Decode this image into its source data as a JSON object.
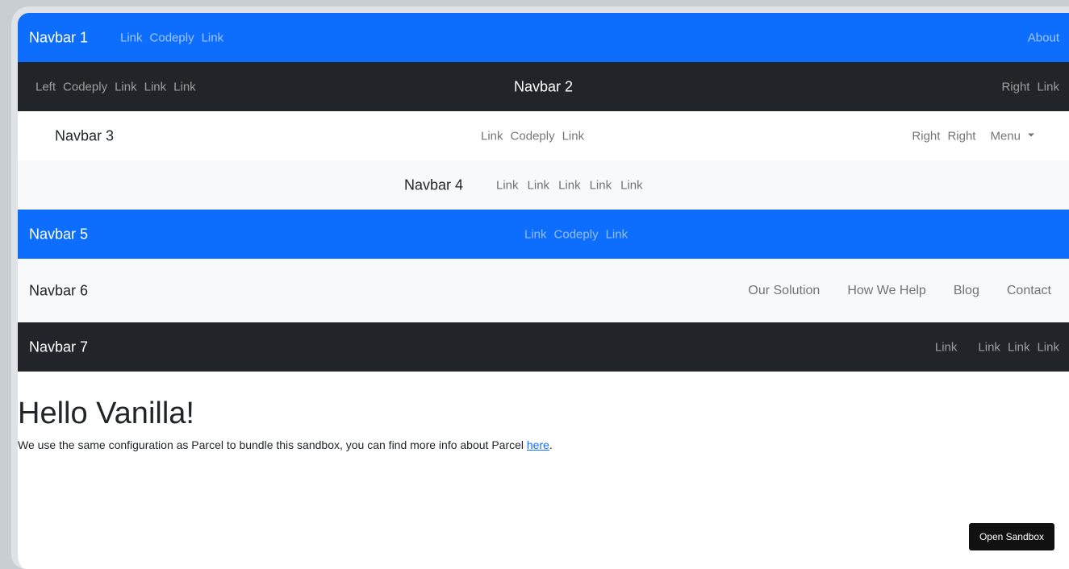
{
  "navbar1": {
    "brand": "Navbar 1",
    "links": [
      "Link",
      "Codeply",
      "Link"
    ],
    "right": "About"
  },
  "navbar2": {
    "left_links": [
      "Left",
      "Codeply",
      "Link",
      "Link",
      "Link"
    ],
    "brand": "Navbar 2",
    "right_links": [
      "Right",
      "Link"
    ]
  },
  "navbar3": {
    "brand": "Navbar 3",
    "center_links": [
      "Link",
      "Codeply",
      "Link"
    ],
    "right_links": [
      "Right",
      "Right"
    ],
    "menu": "Menu"
  },
  "navbar4": {
    "brand": "Navbar 4",
    "links": [
      "Link",
      "Link",
      "Link",
      "Link",
      "Link"
    ]
  },
  "navbar5": {
    "brand": "Navbar 5",
    "links": [
      "Link",
      "Codeply",
      "Link"
    ]
  },
  "navbar6": {
    "brand": "Navbar 6",
    "links": [
      "Our Solution",
      "How We Help",
      "Blog",
      "Contact"
    ]
  },
  "navbar7": {
    "brand": "Navbar 7",
    "links": [
      "Link",
      "Link",
      "Link",
      "Link"
    ]
  },
  "main": {
    "heading": "Hello Vanilla!",
    "paragraph_text": "We use the same configuration as Parcel to bundle this sandbox, you can find more info about Parcel ",
    "link_text": "here",
    "paragraph_end": "."
  },
  "open_sandbox_label": "Open Sandbox",
  "colors": {
    "primary": "#0d6efd",
    "dark": "#212529",
    "light": "#f8f9fa"
  }
}
